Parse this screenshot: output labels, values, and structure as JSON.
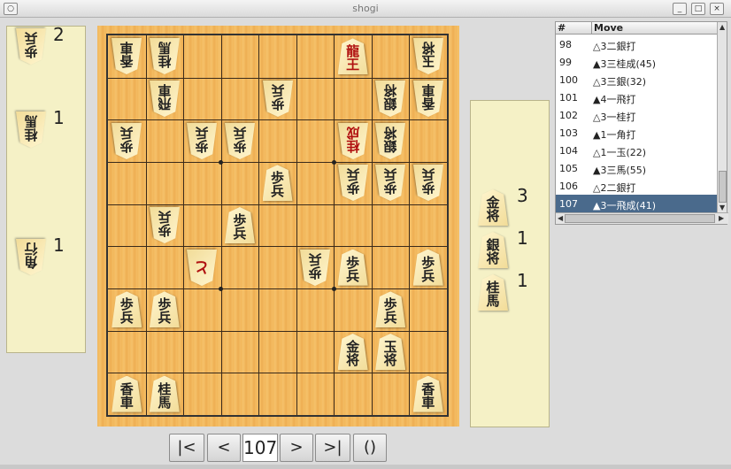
{
  "window": {
    "title": "shogi"
  },
  "hand_gote": [
    {
      "kanji": [
        "歩",
        "兵"
      ],
      "count": "2"
    },
    {
      "kanji": [
        "桂",
        "馬"
      ],
      "count": "1"
    },
    {
      "kanji": [
        "角",
        "行"
      ],
      "count": "1"
    }
  ],
  "hand_sente": [
    {
      "kanji": [
        "金",
        "将"
      ],
      "count": "3"
    },
    {
      "kanji": [
        "銀",
        "将"
      ],
      "count": "1"
    },
    {
      "kanji": [
        "桂",
        "馬"
      ],
      "count": "1"
    }
  ],
  "board_pieces": [
    {
      "file": 9,
      "rank": 1,
      "owner": "gote",
      "kanji": [
        "香",
        "車"
      ]
    },
    {
      "file": 8,
      "rank": 1,
      "owner": "gote",
      "kanji": [
        "桂",
        "馬"
      ]
    },
    {
      "file": 3,
      "rank": 1,
      "owner": "sente",
      "kanji": [
        "龍",
        "王"
      ],
      "promo": true
    },
    {
      "file": 1,
      "rank": 1,
      "owner": "gote",
      "kanji": [
        "玉",
        "将"
      ]
    },
    {
      "file": 8,
      "rank": 2,
      "owner": "gote",
      "kanji": [
        "飛",
        "車"
      ]
    },
    {
      "file": 5,
      "rank": 2,
      "owner": "gote",
      "kanji": [
        "歩",
        "兵"
      ]
    },
    {
      "file": 2,
      "rank": 2,
      "owner": "gote",
      "kanji": [
        "銀",
        "将"
      ]
    },
    {
      "file": 1,
      "rank": 2,
      "owner": "gote",
      "kanji": [
        "香",
        "車"
      ]
    },
    {
      "file": 9,
      "rank": 3,
      "owner": "gote",
      "kanji": [
        "歩",
        "兵"
      ]
    },
    {
      "file": 7,
      "rank": 3,
      "owner": "gote",
      "kanji": [
        "歩",
        "兵"
      ]
    },
    {
      "file": 6,
      "rank": 3,
      "owner": "gote",
      "kanji": [
        "歩",
        "兵"
      ]
    },
    {
      "file": 3,
      "rank": 3,
      "owner": "gote",
      "kanji": [
        "桂",
        "成"
      ],
      "promo": true
    },
    {
      "file": 2,
      "rank": 3,
      "owner": "gote",
      "kanji": [
        "銀",
        "将"
      ]
    },
    {
      "file": 5,
      "rank": 4,
      "owner": "sente",
      "kanji": [
        "歩",
        "兵"
      ]
    },
    {
      "file": 3,
      "rank": 4,
      "owner": "gote",
      "kanji": [
        "歩",
        "兵"
      ]
    },
    {
      "file": 2,
      "rank": 4,
      "owner": "gote",
      "kanji": [
        "歩",
        "兵"
      ]
    },
    {
      "file": 1,
      "rank": 4,
      "owner": "gote",
      "kanji": [
        "歩",
        "兵"
      ]
    },
    {
      "file": 8,
      "rank": 5,
      "owner": "gote",
      "kanji": [
        "歩",
        "兵"
      ]
    },
    {
      "file": 6,
      "rank": 5,
      "owner": "sente",
      "kanji": [
        "歩",
        "兵"
      ]
    },
    {
      "file": 7,
      "rank": 6,
      "owner": "gote",
      "kanji": [
        "と"
      ],
      "promo": true,
      "single": true
    },
    {
      "file": 4,
      "rank": 6,
      "owner": "gote",
      "kanji": [
        "歩",
        "兵"
      ]
    },
    {
      "file": 3,
      "rank": 6,
      "owner": "sente",
      "kanji": [
        "歩",
        "兵"
      ]
    },
    {
      "file": 1,
      "rank": 6,
      "owner": "sente",
      "kanji": [
        "歩",
        "兵"
      ]
    },
    {
      "file": 9,
      "rank": 7,
      "owner": "sente",
      "kanji": [
        "歩",
        "兵"
      ]
    },
    {
      "file": 8,
      "rank": 7,
      "owner": "sente",
      "kanji": [
        "歩",
        "兵"
      ]
    },
    {
      "file": 2,
      "rank": 7,
      "owner": "sente",
      "kanji": [
        "歩",
        "兵"
      ]
    },
    {
      "file": 3,
      "rank": 8,
      "owner": "sente",
      "kanji": [
        "金",
        "将"
      ]
    },
    {
      "file": 2,
      "rank": 8,
      "owner": "sente",
      "kanji": [
        "玉",
        "将"
      ]
    },
    {
      "file": 9,
      "rank": 9,
      "owner": "sente",
      "kanji": [
        "香",
        "車"
      ]
    },
    {
      "file": 8,
      "rank": 9,
      "owner": "sente",
      "kanji": [
        "桂",
        "馬"
      ]
    },
    {
      "file": 1,
      "rank": 9,
      "owner": "sente",
      "kanji": [
        "香",
        "車"
      ]
    }
  ],
  "move_list": {
    "header_num": "#",
    "header_move": "Move",
    "rows": [
      {
        "n": "98",
        "move": "△3二銀打"
      },
      {
        "n": "99",
        "move": "▲3三桂成(45)"
      },
      {
        "n": "100",
        "move": "△3三銀(32)"
      },
      {
        "n": "101",
        "move": "▲4一飛打"
      },
      {
        "n": "102",
        "move": "△3一桂打"
      },
      {
        "n": "103",
        "move": "▲1一角打"
      },
      {
        "n": "104",
        "move": "△1一玉(22)"
      },
      {
        "n": "105",
        "move": "▲3三馬(55)"
      },
      {
        "n": "106",
        "move": "△2二銀打"
      },
      {
        "n": "107",
        "move": "▲3一飛成(41)",
        "selected": true
      }
    ]
  },
  "nav": {
    "first": "|<",
    "prev": "<",
    "move_number": "107",
    "next": ">",
    "last": ">|",
    "parens": "()"
  },
  "colors": {
    "selected_row": "#4a6a8c",
    "hand_bg": "#f5f1c6",
    "board_wood": "#f2b65a"
  }
}
